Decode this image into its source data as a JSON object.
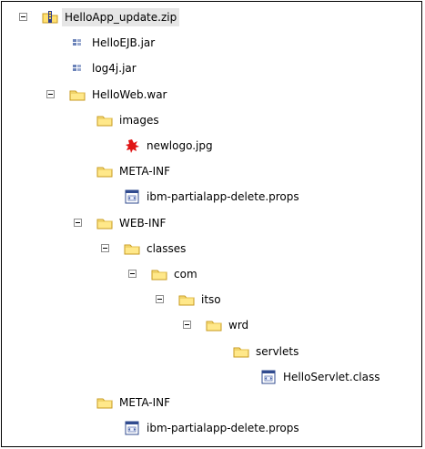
{
  "tree": {
    "nodes": [
      {
        "label": "HelloApp_update.zip",
        "icon": "zip-archive-icon",
        "level": 0,
        "expanded": true,
        "selected": true
      },
      {
        "label": "HelloEJB.jar",
        "icon": "jar-file-icon",
        "level": 1
      },
      {
        "label": "log4j.jar",
        "icon": "jar-file-icon",
        "level": 1
      },
      {
        "label": "HelloWeb.war",
        "icon": "folder-icon",
        "level": 1,
        "expanded": true
      },
      {
        "label": "images",
        "icon": "folder-icon",
        "level": 2
      },
      {
        "label": "newlogo.jpg",
        "icon": "image-file-icon",
        "level": 3
      },
      {
        "label": "META-INF",
        "icon": "folder-icon",
        "level": 2
      },
      {
        "label": "ibm-partialapp-delete.props",
        "icon": "props-file-icon",
        "level": 3
      },
      {
        "label": "WEB-INF",
        "icon": "folder-icon",
        "level": 2,
        "expanded": true
      },
      {
        "label": "classes",
        "icon": "folder-icon",
        "level": 3,
        "expanded": true
      },
      {
        "label": "com",
        "icon": "folder-icon",
        "level": 4,
        "expanded": true
      },
      {
        "label": "itso",
        "icon": "folder-icon",
        "level": 5,
        "expanded": true
      },
      {
        "label": "wrd",
        "icon": "folder-icon",
        "level": 6,
        "expanded": true
      },
      {
        "label": "servlets",
        "icon": "folder-icon",
        "level": 7
      },
      {
        "label": "HelloServlet.class",
        "icon": "class-file-icon",
        "level": 8
      },
      {
        "label": "META-INF",
        "icon": "folder-icon",
        "level": 2
      },
      {
        "label": "ibm-partialapp-delete.props",
        "icon": "props-file-icon",
        "level": 3
      }
    ]
  }
}
